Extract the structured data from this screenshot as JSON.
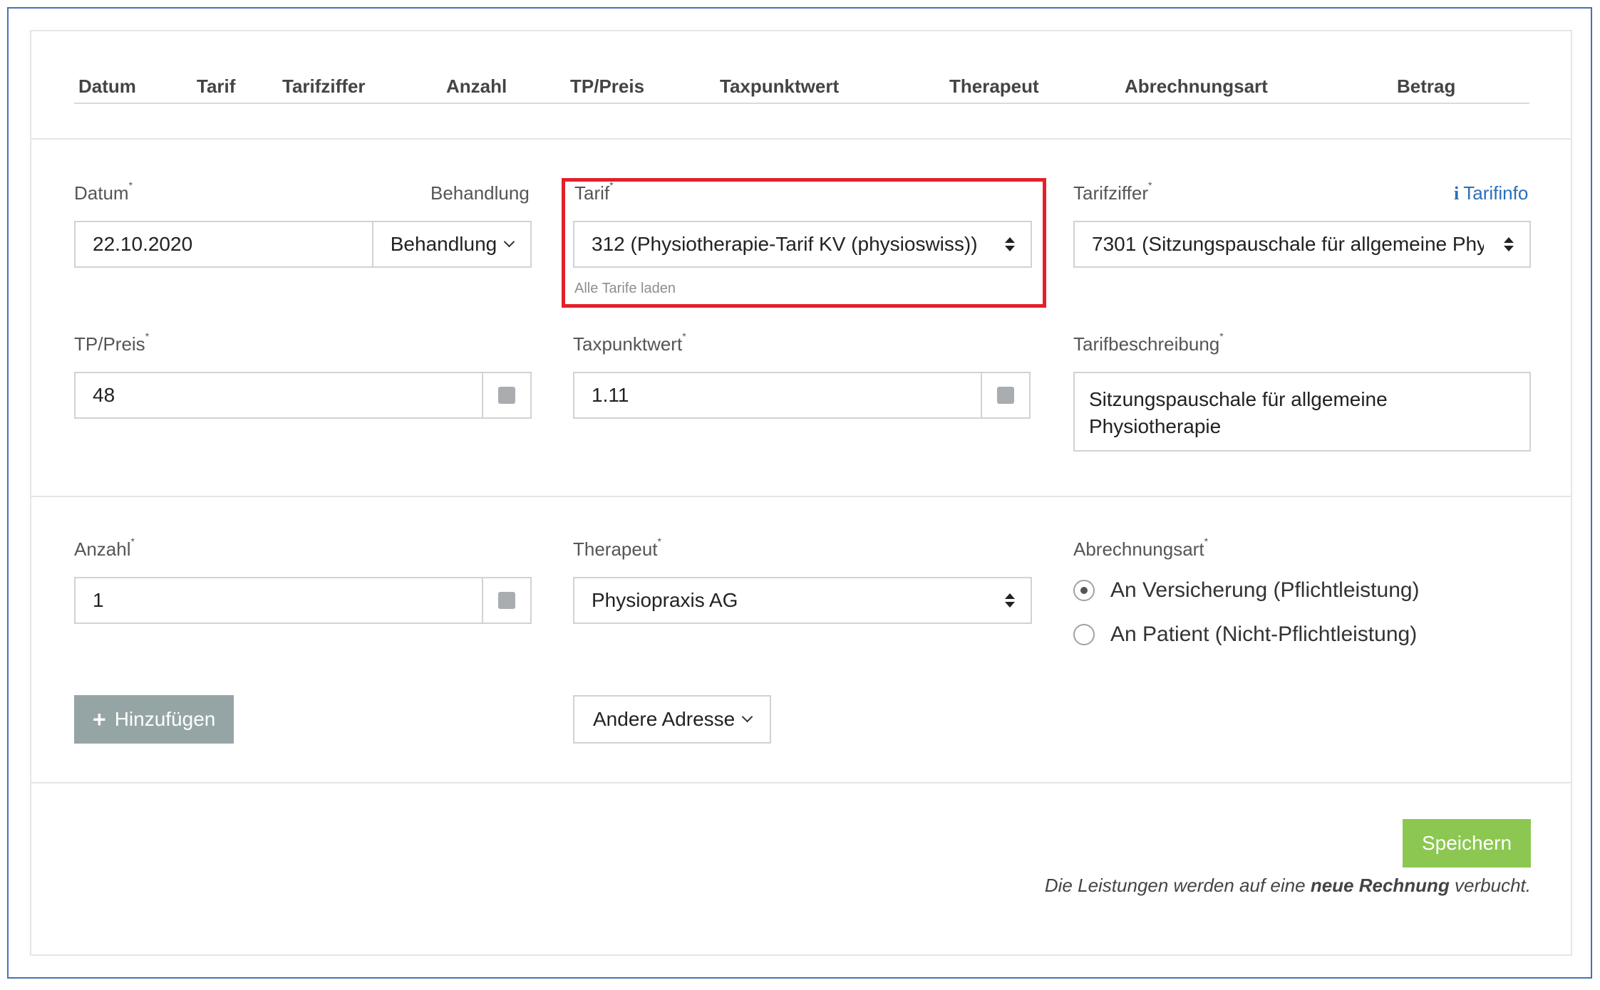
{
  "table_header": {
    "columns": [
      "Datum",
      "Tarif",
      "Tarifziffer",
      "Anzahl",
      "TP/Preis",
      "Taxpunktwert",
      "Therapeut",
      "Abrechnungsart",
      "Betrag"
    ]
  },
  "form": {
    "datum": {
      "label": "Datum",
      "value": "22.10.2020",
      "required": "*"
    },
    "behandlung": {
      "label": "Behandlung",
      "button_label": "Behandlung"
    },
    "tarif": {
      "label": "Tarif",
      "required": "*",
      "value": "312 (Physiotherapie-Tarif KV (physioswiss))",
      "help": "Alle Tarife laden"
    },
    "tarifziffer": {
      "label": "Tarifziffer",
      "required": "*",
      "value": "7301 (Sitzungspauschale für allgemeine Phy",
      "info_link": "Tarifinfo"
    },
    "tp_preis": {
      "label": "TP/Preis",
      "required": "*",
      "value": "48"
    },
    "taxpunktwert": {
      "label": "Taxpunktwert",
      "required": "*",
      "value": "1.11"
    },
    "tarifbeschreibung": {
      "label": "Tarifbeschreibung",
      "required": "*",
      "line1": "Sitzungspauschale für allgemeine",
      "line2": "Physiotherapie"
    },
    "anzahl": {
      "label": "Anzahl",
      "required": "*",
      "value": "1"
    },
    "therapeut": {
      "label": "Therapeut",
      "required": "*",
      "value": "Physiopraxis AG"
    },
    "abrechnungsart": {
      "label": "Abrechnungsart",
      "required": "*",
      "options": [
        "An Versicherung (Pflichtleistung)",
        "An Patient (Nicht-Pflichtleistung)"
      ],
      "selected_index": 0
    }
  },
  "actions": {
    "add_label": "Hinzufügen",
    "add_icon": "+",
    "address_label": "Andere Adresse",
    "save_label": "Speichern"
  },
  "footer_note": {
    "prefix": "Die Leistungen werden auf eine ",
    "bold": "neue Rechnung",
    "suffix": " verbucht."
  },
  "colors": {
    "accent_link": "#2a6ebb",
    "save_green": "#8cc751",
    "add_gray": "#95a5a6",
    "highlight_red": "#e3202a",
    "frame_blue": "#4a70b5"
  }
}
